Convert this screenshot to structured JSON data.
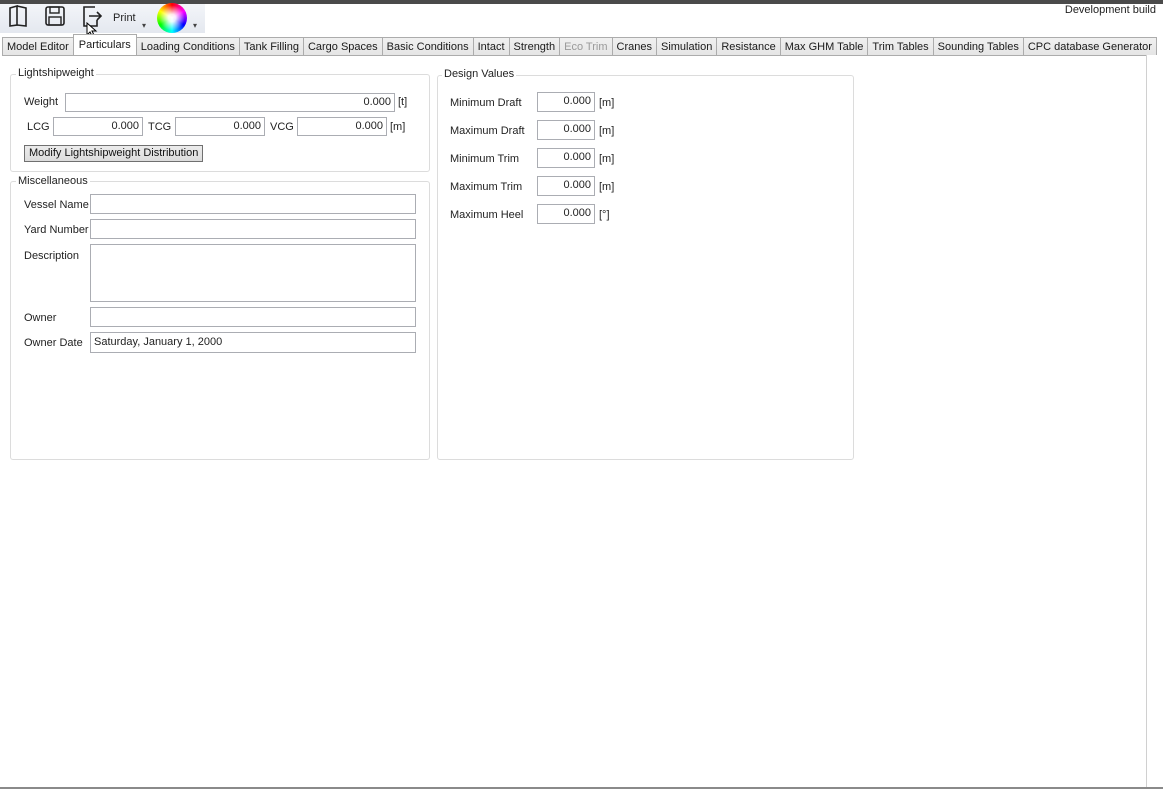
{
  "toolbar": {
    "print_label": "Print",
    "dev_build": "Development build"
  },
  "tabs": [
    {
      "label": "Model Editor",
      "state": "normal"
    },
    {
      "label": "Particulars",
      "state": "active"
    },
    {
      "label": "Loading Conditions",
      "state": "normal"
    },
    {
      "label": "Tank Filling",
      "state": "normal"
    },
    {
      "label": "Cargo Spaces",
      "state": "normal"
    },
    {
      "label": "Basic Conditions",
      "state": "normal"
    },
    {
      "label": "Intact",
      "state": "normal"
    },
    {
      "label": "Strength",
      "state": "normal"
    },
    {
      "label": "Eco Trim",
      "state": "disabled"
    },
    {
      "label": "Cranes",
      "state": "normal"
    },
    {
      "label": "Simulation",
      "state": "normal"
    },
    {
      "label": "Resistance",
      "state": "normal"
    },
    {
      "label": "Max GHM Table",
      "state": "normal"
    },
    {
      "label": "Trim Tables",
      "state": "normal"
    },
    {
      "label": "Sounding Tables",
      "state": "normal"
    },
    {
      "label": "CPC database Generator",
      "state": "normal"
    }
  ],
  "lightship": {
    "title": "Lightshipweight",
    "weight_label": "Weight",
    "weight_value": "0.000",
    "weight_unit": "[t]",
    "lcg_label": "LCG",
    "lcg_value": "0.000",
    "tcg_label": "TCG",
    "tcg_value": "0.000",
    "vcg_label": "VCG",
    "vcg_value": "0.000",
    "cg_unit": "[m]",
    "modify_button": "Modify Lightshipweight Distribution"
  },
  "misc": {
    "title": "Miscellaneous",
    "vessel_name_label": "Vessel Name",
    "vessel_name_value": "",
    "yard_number_label": "Yard Number",
    "yard_number_value": "",
    "description_label": "Description",
    "description_value": "",
    "owner_label": "Owner",
    "owner_value": "",
    "owner_date_label": "Owner Date",
    "owner_date_value": "Saturday, January 1, 2000"
  },
  "design": {
    "title": "Design Values",
    "rows": [
      {
        "label": "Minimum Draft",
        "value": "0.000",
        "unit": "[m]"
      },
      {
        "label": "Maximum Draft",
        "value": "0.000",
        "unit": "[m]"
      },
      {
        "label": "Minimum Trim",
        "value": "0.000",
        "unit": "[m]"
      },
      {
        "label": "Maximum Trim",
        "value": "0.000",
        "unit": "[m]"
      },
      {
        "label": "Maximum Heel",
        "value": "0.000",
        "unit": "[°]"
      }
    ]
  }
}
